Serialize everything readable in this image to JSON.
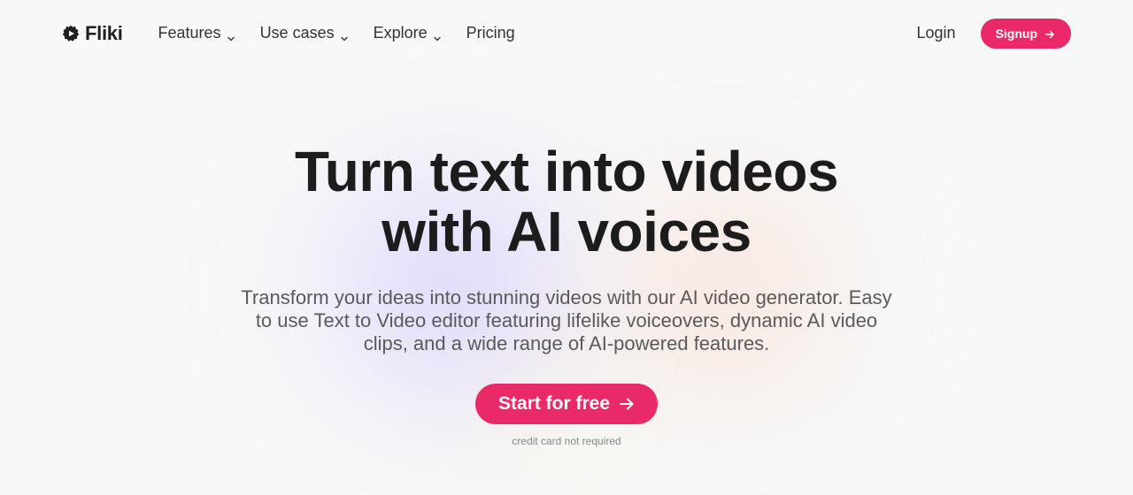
{
  "brand": {
    "name": "Fliki",
    "logo_icon": "fliki-gear-play-icon",
    "accent_color": "#ea2a68"
  },
  "nav": {
    "items": [
      {
        "label": "Features",
        "has_dropdown": true
      },
      {
        "label": "Use cases",
        "has_dropdown": true
      },
      {
        "label": "Explore",
        "has_dropdown": true
      },
      {
        "label": "Pricing",
        "has_dropdown": false
      }
    ],
    "login_label": "Login",
    "signup_label": "Signup"
  },
  "hero": {
    "headline_line1": "Turn text into videos",
    "headline_line2": "with AI voices",
    "subtitle": "Transform your ideas into stunning videos with our AI video generator. Easy to use Text to Video editor featuring lifelike voiceovers, dynamic AI video clips, and a wide range of AI-powered features.",
    "cta_label": "Start for free",
    "cta_note": "credit card not required"
  }
}
